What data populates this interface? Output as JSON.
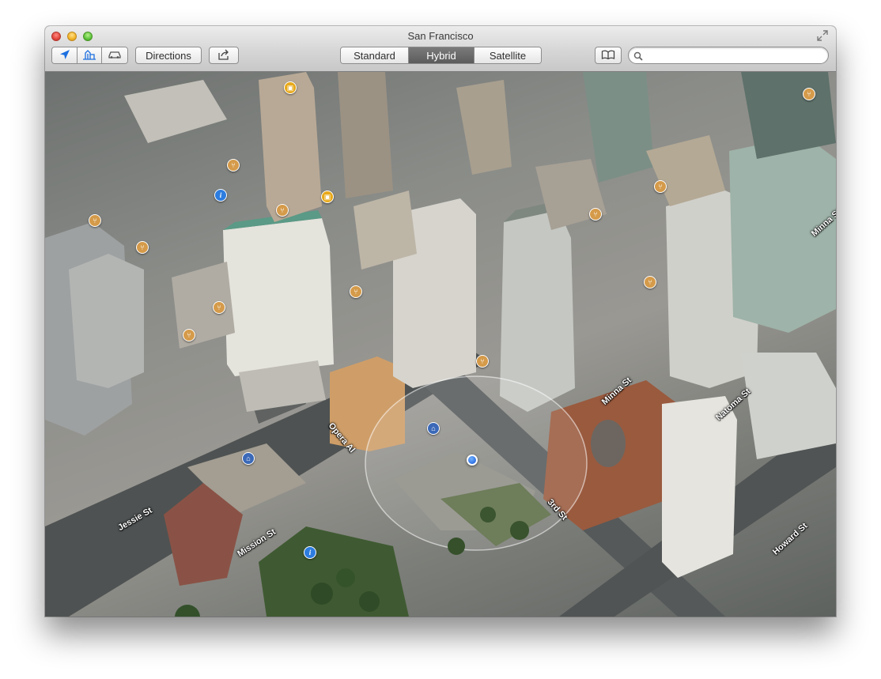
{
  "window": {
    "title": "San Francisco"
  },
  "toolbar": {
    "directions_label": "Directions",
    "map_modes": [
      "Standard",
      "Hybrid",
      "Satellite"
    ],
    "active_mode": "Hybrid",
    "search_placeholder": ""
  },
  "icons": {
    "location": "location-arrow-icon",
    "view_3d": "3d-buildings-icon",
    "traffic": "traffic-car-icon",
    "share": "share-icon",
    "bookmarks": "bookmarks-book-icon",
    "search": "magnifier-icon",
    "fullscreen": "fullscreen-arrows-icon",
    "compass": "compass-icon"
  },
  "map": {
    "street_labels": [
      "Minna St",
      "Minna St",
      "Natoma St",
      "Opera Al",
      "Jessie St",
      "Mission St",
      "3rd St",
      "Howard St"
    ],
    "poi_types": [
      "food",
      "shop",
      "info",
      "museum"
    ]
  },
  "zoom": {
    "minus": "−",
    "plus": "+"
  },
  "colors": {
    "accent": "#2d7de0",
    "active_segment": "#666666",
    "compass_needle": "#d32a20"
  }
}
